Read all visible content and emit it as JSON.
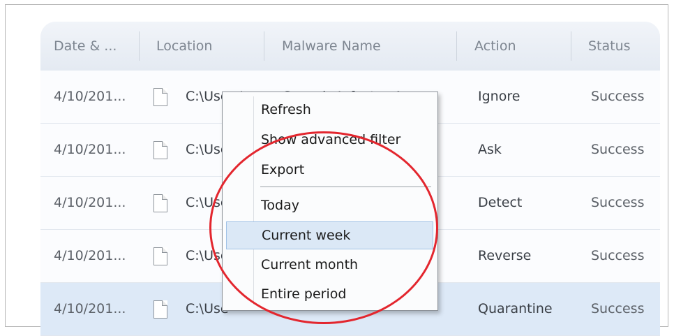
{
  "table": {
    "columns": [
      "Date & ...",
      "Location",
      "Malware Name",
      "Action",
      "Status"
    ],
    "rows": [
      {
        "date": "4/10/201...",
        "location": "C:\\Users\\",
        "malware": "Generic Infector 4",
        "action": "Ignore",
        "status": "Success"
      },
      {
        "date": "4/10/201...",
        "location": "C:\\Use",
        "malware": "",
        "action": "Ask",
        "status": "Success"
      },
      {
        "date": "4/10/201...",
        "location": "C:\\Use",
        "malware": "",
        "action": "Detect",
        "status": "Success"
      },
      {
        "date": "4/10/201...",
        "location": "C:\\Use",
        "malware": "",
        "action": "Reverse",
        "status": "Success"
      },
      {
        "date": "4/10/201...",
        "location": "C:\\Use",
        "malware": "",
        "action": "Quarantine",
        "status": "Success"
      }
    ]
  },
  "context_menu": {
    "items": [
      "Refresh",
      "Show advanced filter",
      "Export",
      "Today",
      "Current week",
      "Current month",
      "Entire period"
    ],
    "hovered": "Current week"
  },
  "icons": {
    "file": "file-icon"
  },
  "colors": {
    "highlight_ellipse": "#e3262e",
    "selected_row": "#dde9f7",
    "menu_hover": "#dbe8f6"
  }
}
